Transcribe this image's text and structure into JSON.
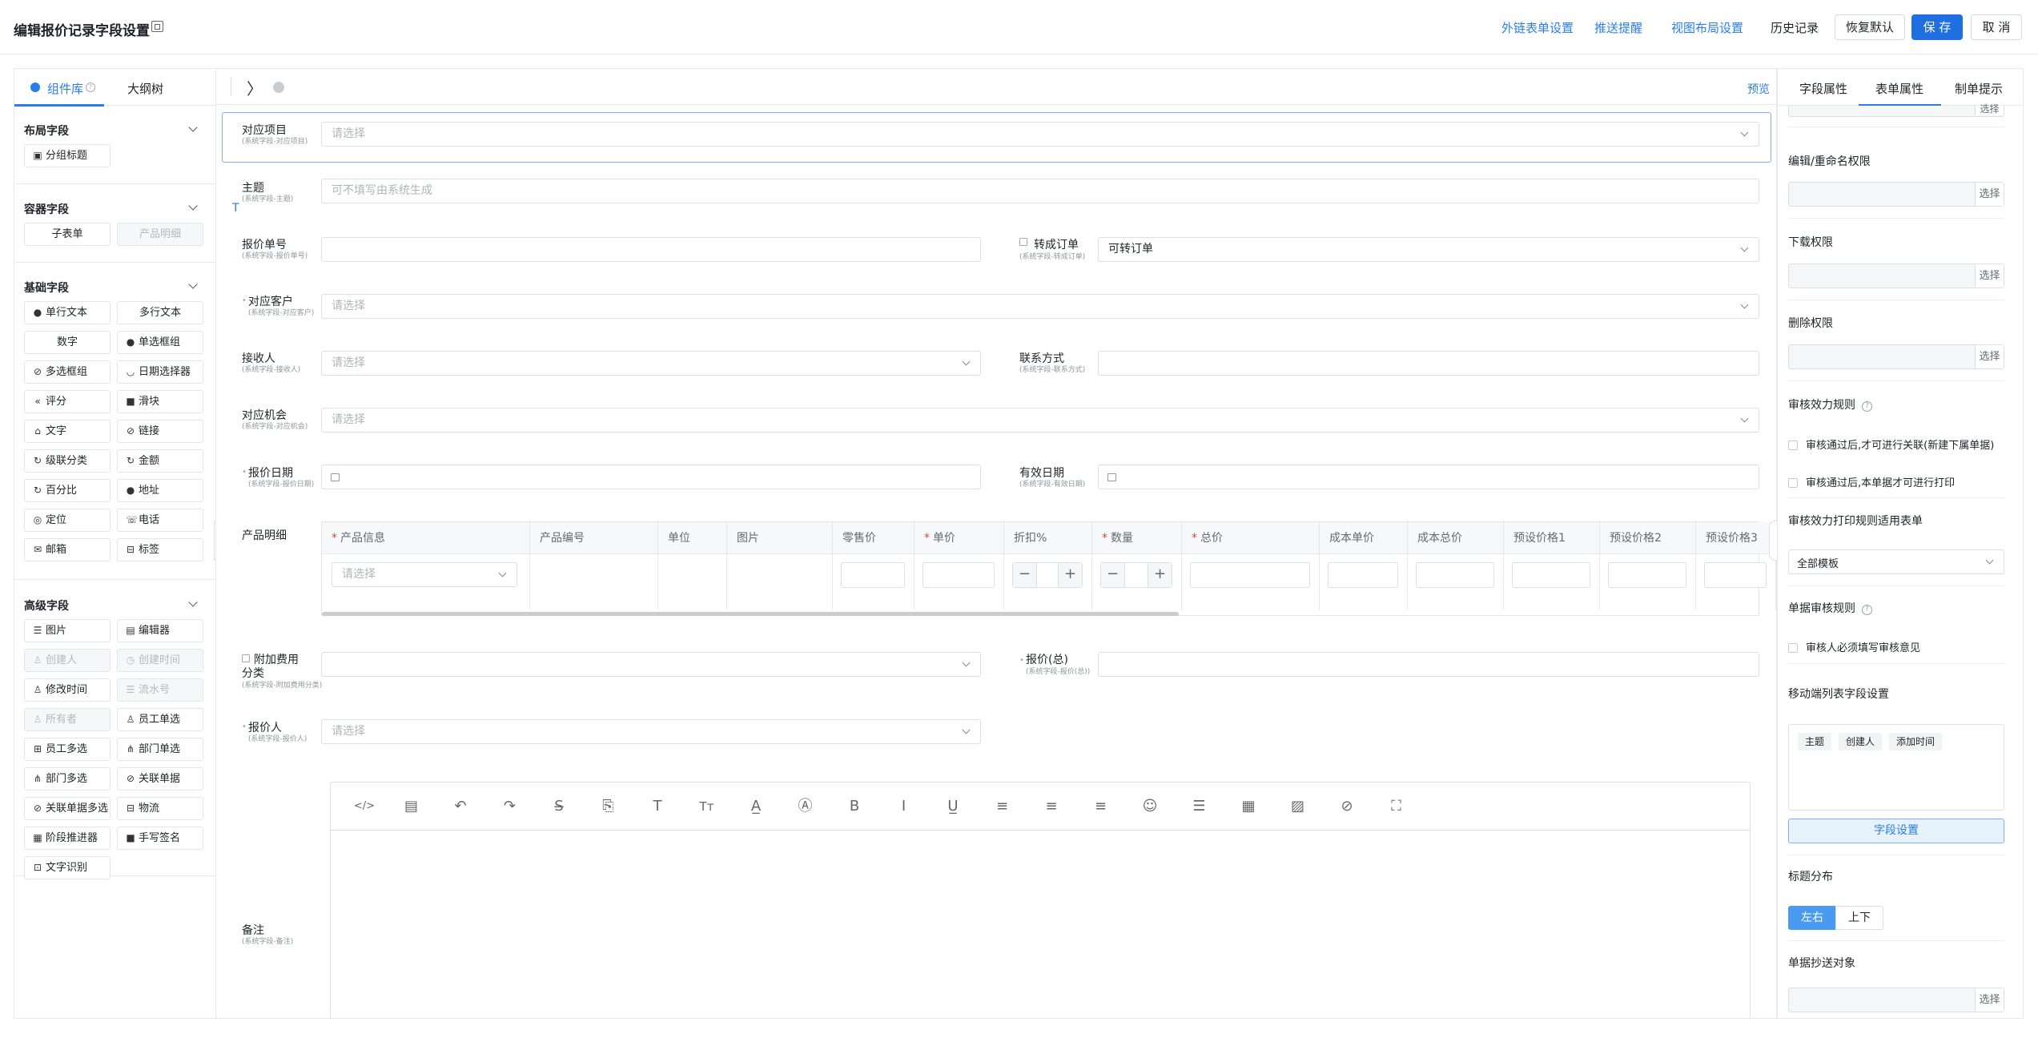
{
  "header": {
    "title": "编辑报价记录字段设置",
    "links": [
      "外链表单设置",
      "推送提醒",
      "视图布局设置"
    ],
    "history": "历史记录",
    "restore": "恢复默认",
    "save": "保 存",
    "cancel": "取 消"
  },
  "left": {
    "tabs": [
      "组件库",
      "大纲树"
    ],
    "sections": [
      {
        "title": "布局字段",
        "items": [
          {
            "label": "分组标题",
            "icon": "group-title-icon",
            "disabled": false
          }
        ]
      },
      {
        "title": "容器字段",
        "items": [
          {
            "label": "子表单",
            "icon": "",
            "disabled": false
          },
          {
            "label": "产品明细",
            "icon": "",
            "disabled": true
          }
        ]
      },
      {
        "title": "基础字段",
        "items": [
          {
            "label": "单行文本",
            "icon": "text-icon",
            "disabled": false
          },
          {
            "label": "多行文本",
            "icon": "",
            "disabled": false
          },
          {
            "label": "数字",
            "icon": "",
            "disabled": false
          },
          {
            "label": "单选框组",
            "icon": "radio-icon",
            "disabled": false
          },
          {
            "label": "多选框组",
            "icon": "checkbox-icon",
            "disabled": false
          },
          {
            "label": "日期选择器",
            "icon": "date-icon",
            "disabled": false
          },
          {
            "label": "评分",
            "icon": "rating-icon",
            "disabled": false
          },
          {
            "label": "滑块",
            "icon": "slider-icon",
            "disabled": false
          },
          {
            "label": "文字",
            "icon": "letter-icon",
            "disabled": false
          },
          {
            "label": "链接",
            "icon": "link-icon",
            "disabled": false
          },
          {
            "label": "级联分类",
            "icon": "cascade-icon",
            "disabled": false
          },
          {
            "label": "金额",
            "icon": "money-icon",
            "disabled": false
          },
          {
            "label": "百分比",
            "icon": "percent-icon",
            "disabled": false
          },
          {
            "label": "地址",
            "icon": "address-icon",
            "disabled": false
          },
          {
            "label": "定位",
            "icon": "location-icon",
            "disabled": false
          },
          {
            "label": "电话",
            "icon": "phone-icon",
            "disabled": false
          },
          {
            "label": "邮箱",
            "icon": "mail-icon",
            "disabled": false
          },
          {
            "label": "标签",
            "icon": "tag-icon",
            "disabled": false
          }
        ]
      },
      {
        "title": "高级字段",
        "items": [
          {
            "label": "图片",
            "icon": "image-icon",
            "disabled": false
          },
          {
            "label": "编辑器",
            "icon": "editor-icon",
            "disabled": false
          },
          {
            "label": "创建人",
            "icon": "user-icon",
            "disabled": true
          },
          {
            "label": "创建时间",
            "icon": "clock-icon",
            "disabled": true
          },
          {
            "label": "修改时间",
            "icon": "user-icon",
            "disabled": false
          },
          {
            "label": "流水号",
            "icon": "serial-icon",
            "disabled": true
          },
          {
            "label": "所有者",
            "icon": "user-icon",
            "disabled": true
          },
          {
            "label": "员工单选",
            "icon": "user-icon",
            "disabled": false
          },
          {
            "label": "员工多选",
            "icon": "users-icon",
            "disabled": false
          },
          {
            "label": "部门单选",
            "icon": "dept-icon",
            "disabled": false
          },
          {
            "label": "部门多选",
            "icon": "dept-icon",
            "disabled": false
          },
          {
            "label": "关联单据",
            "icon": "link-icon",
            "disabled": false
          },
          {
            "label": "关联单据多选",
            "icon": "link-icon",
            "disabled": false
          },
          {
            "label": "物流",
            "icon": "logistics-icon",
            "disabled": false
          },
          {
            "label": "阶段推进器",
            "icon": "stage-icon",
            "disabled": false
          },
          {
            "label": "手写签名",
            "icon": "sign-icon",
            "disabled": false
          },
          {
            "label": "文字识别",
            "icon": "ocr-icon",
            "disabled": false
          }
        ]
      }
    ]
  },
  "center": {
    "preview": "预览",
    "fields": {
      "project": {
        "label": "对应项目",
        "sub": "(系统字段-对应项目)",
        "placeholder": "请选择"
      },
      "subject": {
        "label": "主题",
        "sub": "(系统字段-主题)",
        "placeholder": "可不填写由系统生成"
      },
      "quote_no": {
        "label": "报价单号",
        "sub": "(系统字段-报价单号)",
        "placeholder": ""
      },
      "to_order": {
        "label": "转成订单",
        "sub": "(系统字段-转成订单)",
        "value": "可转订单"
      },
      "customer": {
        "label": "对应客户",
        "sub": "(系统字段-对应客户)",
        "placeholder": "请选择"
      },
      "receiver": {
        "label": "接收人",
        "sub": "(系统字段-接收人)",
        "placeholder": "请选择"
      },
      "contact": {
        "label": "联系方式",
        "sub": "(系统字段-联系方式)",
        "placeholder": ""
      },
      "opportunity": {
        "label": "对应机会",
        "sub": "(系统字段-对应机会)",
        "placeholder": "请选择"
      },
      "quote_date": {
        "label": "报价日期",
        "sub": "(系统字段-报价日期)"
      },
      "valid_date": {
        "label": "有效日期",
        "sub": "(系统字段-有效日期)"
      },
      "products": {
        "label": "产品明细"
      },
      "extra_fee": {
        "label1": "附加费用",
        "label2": "分类",
        "sub": "(系统字段-附加费用分类)"
      },
      "total": {
        "label": "报价(总)",
        "sub": "(系统字段-报价(总))"
      },
      "quoter": {
        "label": "报价人",
        "sub": "(系统字段-报价人)",
        "placeholder": "请选择"
      },
      "remark": {
        "label": "备注",
        "sub": "(系统字段-备注)"
      }
    },
    "table": {
      "columns": [
        {
          "label": "产品信息",
          "required": true
        },
        {
          "label": "产品编号",
          "required": false
        },
        {
          "label": "单位",
          "required": false
        },
        {
          "label": "图片",
          "required": false
        },
        {
          "label": "零售价",
          "required": false
        },
        {
          "label": "单价",
          "required": true
        },
        {
          "label": "折扣%",
          "required": false
        },
        {
          "label": "数量",
          "required": true
        },
        {
          "label": "总价",
          "required": true
        },
        {
          "label": "成本单价",
          "required": false
        },
        {
          "label": "成本总价",
          "required": false
        },
        {
          "label": "预设价格1",
          "required": false
        },
        {
          "label": "预设价格2",
          "required": false
        },
        {
          "label": "预设价格3",
          "required": false
        }
      ],
      "select_placeholder": "请选择",
      "minus": "−",
      "plus": "+"
    },
    "editor_tools": [
      "code-icon",
      "template-icon",
      "undo-icon",
      "redo-icon",
      "strikethrough-icon",
      "clear-format-icon",
      "font-icon",
      "font-size-icon",
      "font-color-icon",
      "bg-color-icon",
      "bold-icon",
      "italic-icon",
      "underline-icon",
      "align-left-icon",
      "align-center-icon",
      "align-right-icon",
      "emoji-icon",
      "hr-icon",
      "table-icon",
      "image-icon",
      "attachment-icon",
      "fullscreen-icon"
    ]
  },
  "right": {
    "tabs": [
      "字段属性",
      "表单属性",
      "制单提示"
    ],
    "select_btn": "选择",
    "edit_perm": "编辑/重命名权限",
    "download_perm": "下载权限",
    "delete_perm": "删除权限",
    "audit_rule": "审核效力规则",
    "audit_opt1": "审核通过后,才可进行关联(新建下属单据)",
    "audit_opt2": "审核通过后,本单据才可进行打印",
    "print_rule": "审核效力打印规则适用表单",
    "print_value": "全部模板",
    "doc_audit": "单据审核规则",
    "doc_audit_opt": "审核人必须填写审核意见",
    "mobile_fields": "移动端列表字段设置",
    "tags": [
      "主题",
      "创建人",
      "添加时间"
    ],
    "field_settings": "字段设置",
    "title_layout": "标题分布",
    "layout_options": [
      "左右",
      "上下"
    ],
    "cc_target": "单据抄送对象"
  },
  "colors": {
    "accent": "#2b7de9",
    "primary": "#1f6fe0",
    "border": "#e6e8eb",
    "required": "#e64340"
  }
}
